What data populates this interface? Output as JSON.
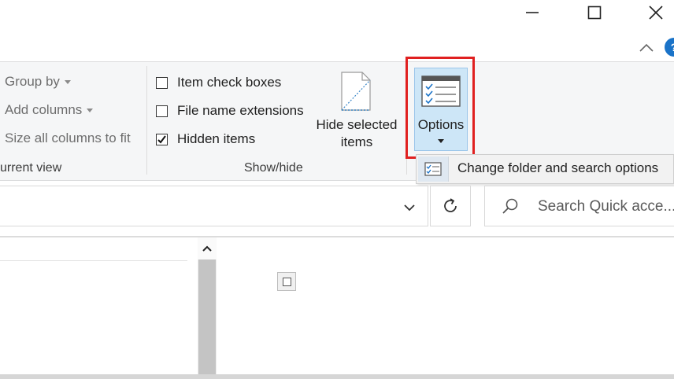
{
  "window": {
    "minimize_icon": "minimize-icon",
    "maximize_icon": "maximize-icon",
    "close_icon": "close-icon",
    "ribbon_toggle_icon": "chevron-up-icon",
    "help_glyph": "?"
  },
  "ribbon": {
    "current_view": {
      "group_by": "Group by",
      "add_columns": "Add columns",
      "size_all_columns": "Size all columns to fit",
      "group_label": "urrent view"
    },
    "show_hide": {
      "item_check_boxes": {
        "label": "Item check boxes",
        "checked": false
      },
      "file_name_extensions": {
        "label": "File name extensions",
        "checked": false
      },
      "hidden_items": {
        "label": "Hidden items",
        "checked": true
      },
      "hide_selected_line1": "Hide selected",
      "hide_selected_line2": "items",
      "group_label": "Show/hide"
    },
    "options": {
      "label": "Options",
      "highlight_color": "#e02020"
    }
  },
  "dropdown": {
    "change_folder_options": "Change folder and search options"
  },
  "address": {
    "path": "",
    "search_placeholder": "Search Quick acce..."
  },
  "colors": {
    "accent": "#1a73c8",
    "options_bg": "#cde6f7",
    "highlight": "#e02020"
  }
}
